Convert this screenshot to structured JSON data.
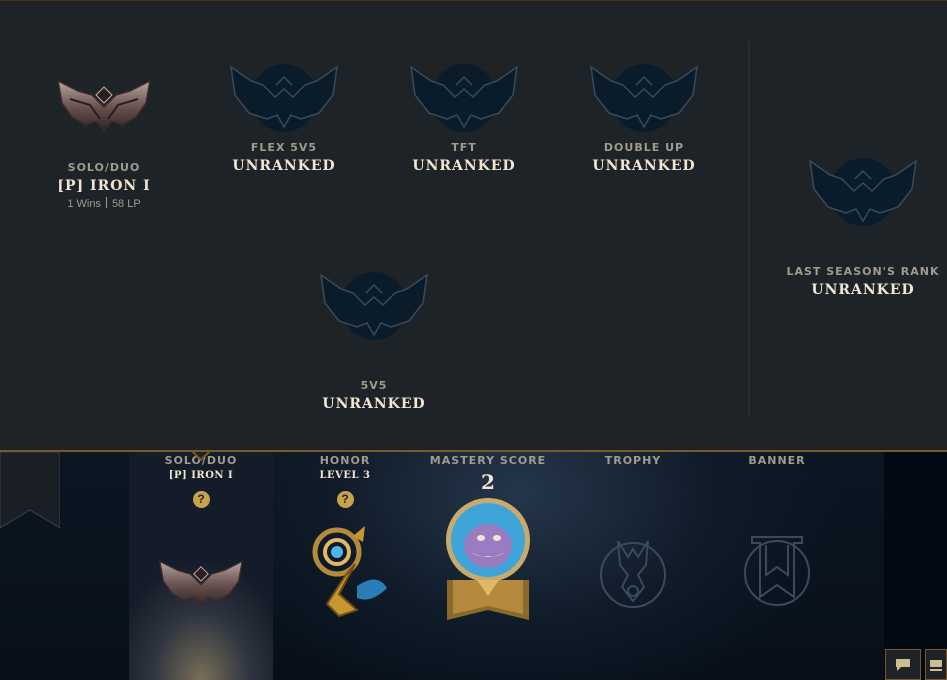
{
  "colors": {
    "gold": "#c8aa6e",
    "gold_dark": "#785a28",
    "popup_bg": "#1e2328",
    "text_light": "#f0e6d2",
    "text_muted": "#a09b8c"
  },
  "ranked_popup": {
    "solo_duo": {
      "queue": "SOLO/DUO",
      "rank": "[P] IRON I",
      "wins": "1 Wins",
      "lp": "58 LP",
      "icon": "iron-emblem-icon"
    },
    "flex": {
      "queue": "FLEX 5V5",
      "rank": "UNRANKED",
      "icon": "unranked-emblem-icon"
    },
    "tft": {
      "queue": "TFT",
      "rank": "UNRANKED",
      "icon": "unranked-emblem-icon"
    },
    "double_up": {
      "queue": "DOUBLE UP",
      "rank": "UNRANKED",
      "icon": "unranked-emblem-icon"
    },
    "fivevfive": {
      "queue": "5V5",
      "rank": "UNRANKED",
      "icon": "unranked-emblem-icon"
    },
    "last_season": {
      "queue": "LAST SEASON'S RANK",
      "rank": "UNRANKED",
      "icon": "unranked-emblem-icon"
    }
  },
  "profile_crests": {
    "solo_duo": {
      "title": "SOLO/DUO",
      "sub": "[P] IRON I",
      "help": "?",
      "icon": "iron-emblem-icon"
    },
    "honor": {
      "title": "HONOR",
      "sub": "LEVEL 3",
      "help": "?",
      "icon": "honor-level-icon"
    },
    "mastery": {
      "title": "MASTERY SCORE",
      "score": "2",
      "icon": "champion-mastery-icon"
    },
    "trophy": {
      "title": "TROPHY",
      "icon": "trophy-icon"
    },
    "banner": {
      "title": "BANNER",
      "icon": "banner-icon"
    }
  },
  "corner_buttons": {
    "chat": "chat-icon",
    "menu": "menu-icon"
  }
}
